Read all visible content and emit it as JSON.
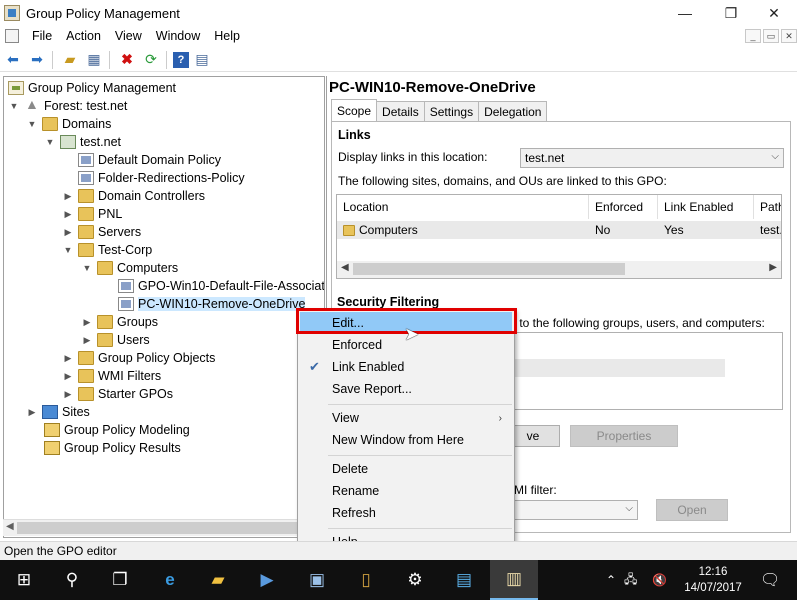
{
  "window": {
    "title": "Group Policy Management"
  },
  "menubar": {
    "items": [
      "File",
      "Action",
      "View",
      "Window",
      "Help"
    ]
  },
  "tree": {
    "root": "Group Policy Management",
    "forest": "Forest: test.net",
    "domains": "Domains",
    "domain": "test.net",
    "default_policy": "Default Domain Policy",
    "folder_redirections": "Folder-Redirections-Policy",
    "domain_controllers": "Domain Controllers",
    "pnl": "PNL",
    "servers": "Servers",
    "test_corp": "Test-Corp",
    "computers": "Computers",
    "gpo_default_file": "GPO-Win10-Default-File-Associat",
    "gpo_remove_onedrive": "PC-WIN10-Remove-OneDrive",
    "groups": "Groups",
    "users": "Users",
    "gpo_objects": "Group Policy Objects",
    "wmi_filters": "WMI Filters",
    "starter_gpos": "Starter GPOs",
    "sites": "Sites",
    "modeling": "Group Policy Modeling",
    "results": "Group Policy Results"
  },
  "details": {
    "gpo_title": "PC-WIN10-Remove-OneDrive",
    "tabs": [
      "Scope",
      "Details",
      "Settings",
      "Delegation"
    ],
    "links_title": "Links",
    "display_links_label": "Display links in this location:",
    "display_links_value": "test.net",
    "linked_desc": "The following sites, domains, and OUs are linked to this GPO:",
    "columns": [
      "Location",
      "Enforced",
      "Link Enabled",
      "Path"
    ],
    "rows": [
      {
        "location": "Computers",
        "enforced": "No",
        "link_enabled": "Yes",
        "path": "test.n"
      }
    ],
    "security_title": "Security Filtering",
    "security_desc_tail": "y to the following groups, users, and computers:",
    "remove_btn_partial": "ve",
    "properties_btn": "Properties",
    "wmi_label_partial": "MI filter:",
    "open_btn": "Open"
  },
  "context_menu": {
    "items": [
      "Edit...",
      "Enforced",
      "Link Enabled",
      "Save Report...",
      "View",
      "New Window from Here",
      "Delete",
      "Rename",
      "Refresh",
      "Help"
    ]
  },
  "status": {
    "text": "Open the GPO editor"
  },
  "taskbar": {
    "time": "12:16",
    "date": "14/07/2017"
  }
}
